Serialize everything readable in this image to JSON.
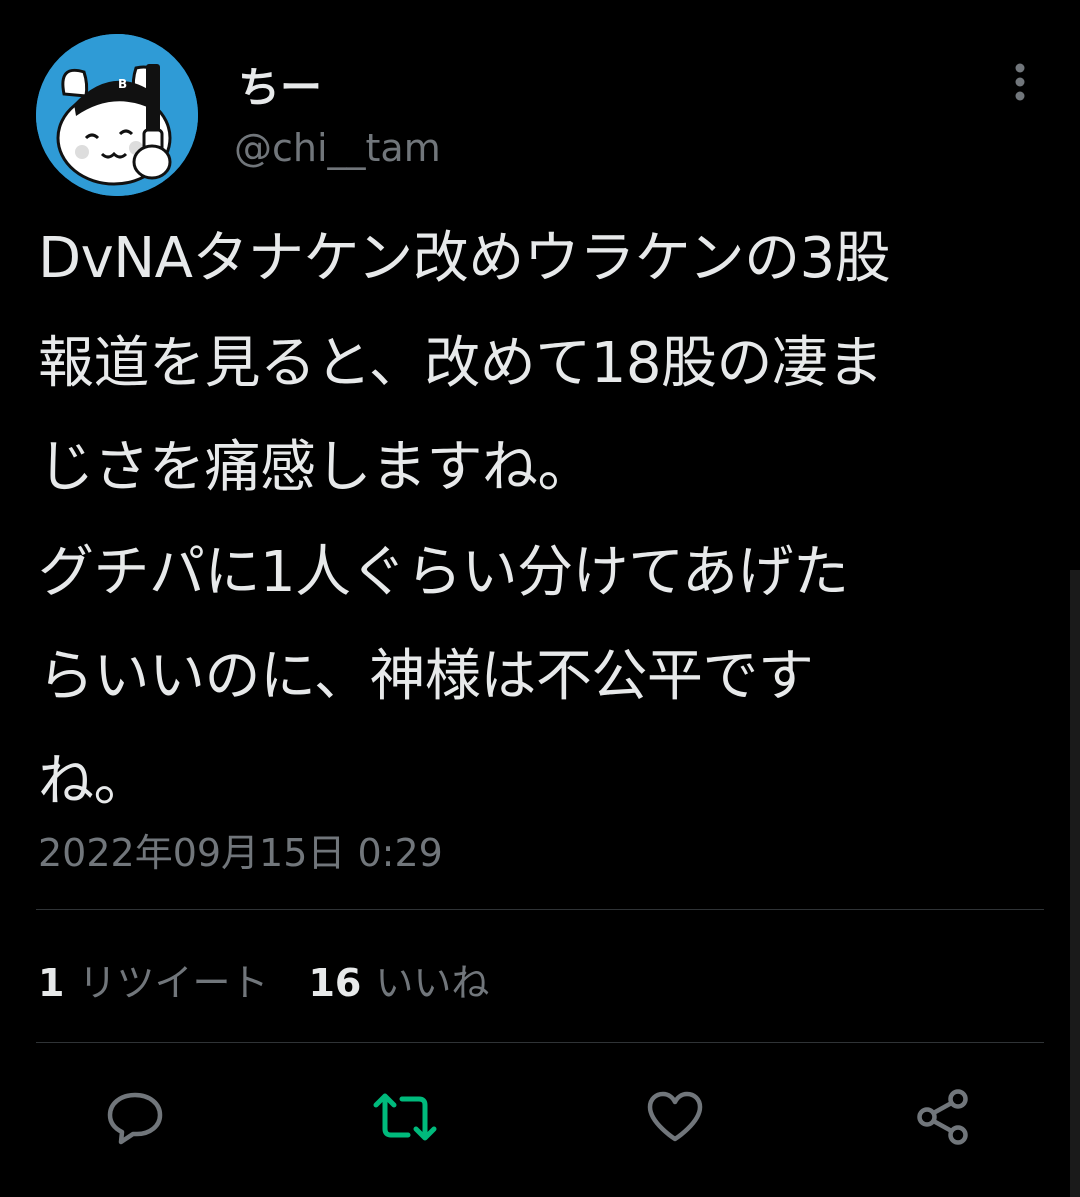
{
  "user": {
    "display_name": "ちー",
    "handle": "@chi__tam"
  },
  "tweet": {
    "text": "DvNAタナケン改めウラケンの3股\n報道を見ると、改めて18股の凄ま\nじさを痛感しますね。\nグチパに1人ぐらい分けてあげた\nらいいのに、神様は不公平です\nね。",
    "timestamp": "2022年09月15日 0:29"
  },
  "stats": {
    "retweet_count": "1",
    "retweet_label": "リツイート",
    "like_count": "16",
    "like_label": "いいね"
  },
  "actions": {
    "reply_icon": "reply-icon",
    "retweet_icon": "retweet-icon",
    "like_icon": "heart-icon",
    "share_icon": "share-icon"
  },
  "colors": {
    "background": "#000000",
    "text": "#e7e9ea",
    "secondary": "#71767b",
    "retweet_active": "#00ba7c",
    "avatar_bg": "#2f9bd6"
  }
}
